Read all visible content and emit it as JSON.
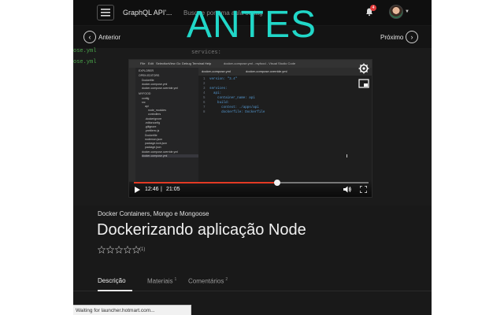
{
  "header": {
    "course_title": "GraphQL API'...",
    "search_placeholder": "Busque por uma aula ou tag",
    "notification_count": "4"
  },
  "nav": {
    "prev_label": "Anterior",
    "next_label": "Próximo"
  },
  "overlay": {
    "text": "ANTES"
  },
  "background_code": {
    "lines": [
      "ose.yml",
      "ose.yml",
      "services:"
    ]
  },
  "video": {
    "editor_window_title": "docker-compose.yml - myfood - Visual Studio Code",
    "menu": [
      "File",
      "Edit",
      "Selection",
      "View",
      "Go",
      "Debug",
      "Terminal",
      "Help"
    ],
    "tabs": [
      "docker-compose.yml",
      "docker-compose.override.yml"
    ],
    "explorer": [
      "EXPLORER",
      "OPEN EDITORS",
      "Dockerfile",
      "docker-compose.yml",
      "docker-compose.override.yml",
      "MYFOOD",
      "config",
      "src",
      "api",
      "node_modules",
      "controllers",
      ".dockerignore",
      ".editorconfig",
      ".gitignore",
      ".prettierrc.js",
      "Dockerfile",
      "nodemon.json",
      "package-lock.json",
      "package.json",
      "docker-compose.override.yml",
      "docker-compose.yml"
    ],
    "code": [
      {
        "n": "1",
        "text": "version: \"3.4\""
      },
      {
        "n": "2",
        "text": ""
      },
      {
        "n": "3",
        "text": "services:"
      },
      {
        "n": "4",
        "text": "  api:"
      },
      {
        "n": "5",
        "text": "    container_name: api"
      },
      {
        "n": "6",
        "text": "    build:"
      },
      {
        "n": "7",
        "text": "      context: ./apps/api"
      },
      {
        "n": "8",
        "text": "      dockerfile: Dockerfile"
      }
    ],
    "time_current": "12:46",
    "time_separator": "|",
    "time_total": "21:05",
    "progress": 0.61
  },
  "lesson": {
    "module": "Docker Containers, Mongo e Mongoose",
    "title": "Dockerizando aplicação Node",
    "rating": 0,
    "rating_max": 5,
    "rating_count": "(1)"
  },
  "tabs": [
    {
      "label": "Descrição",
      "count": ""
    },
    {
      "label": "Materiais",
      "count": "1"
    },
    {
      "label": "Comentários",
      "count": "2"
    }
  ],
  "status_bar": {
    "text": "Waiting for launcher.hotmart.com..."
  },
  "colors": {
    "overlay": "#21d7c8",
    "progress": "#e33a24",
    "badge": "#e03a3a"
  }
}
